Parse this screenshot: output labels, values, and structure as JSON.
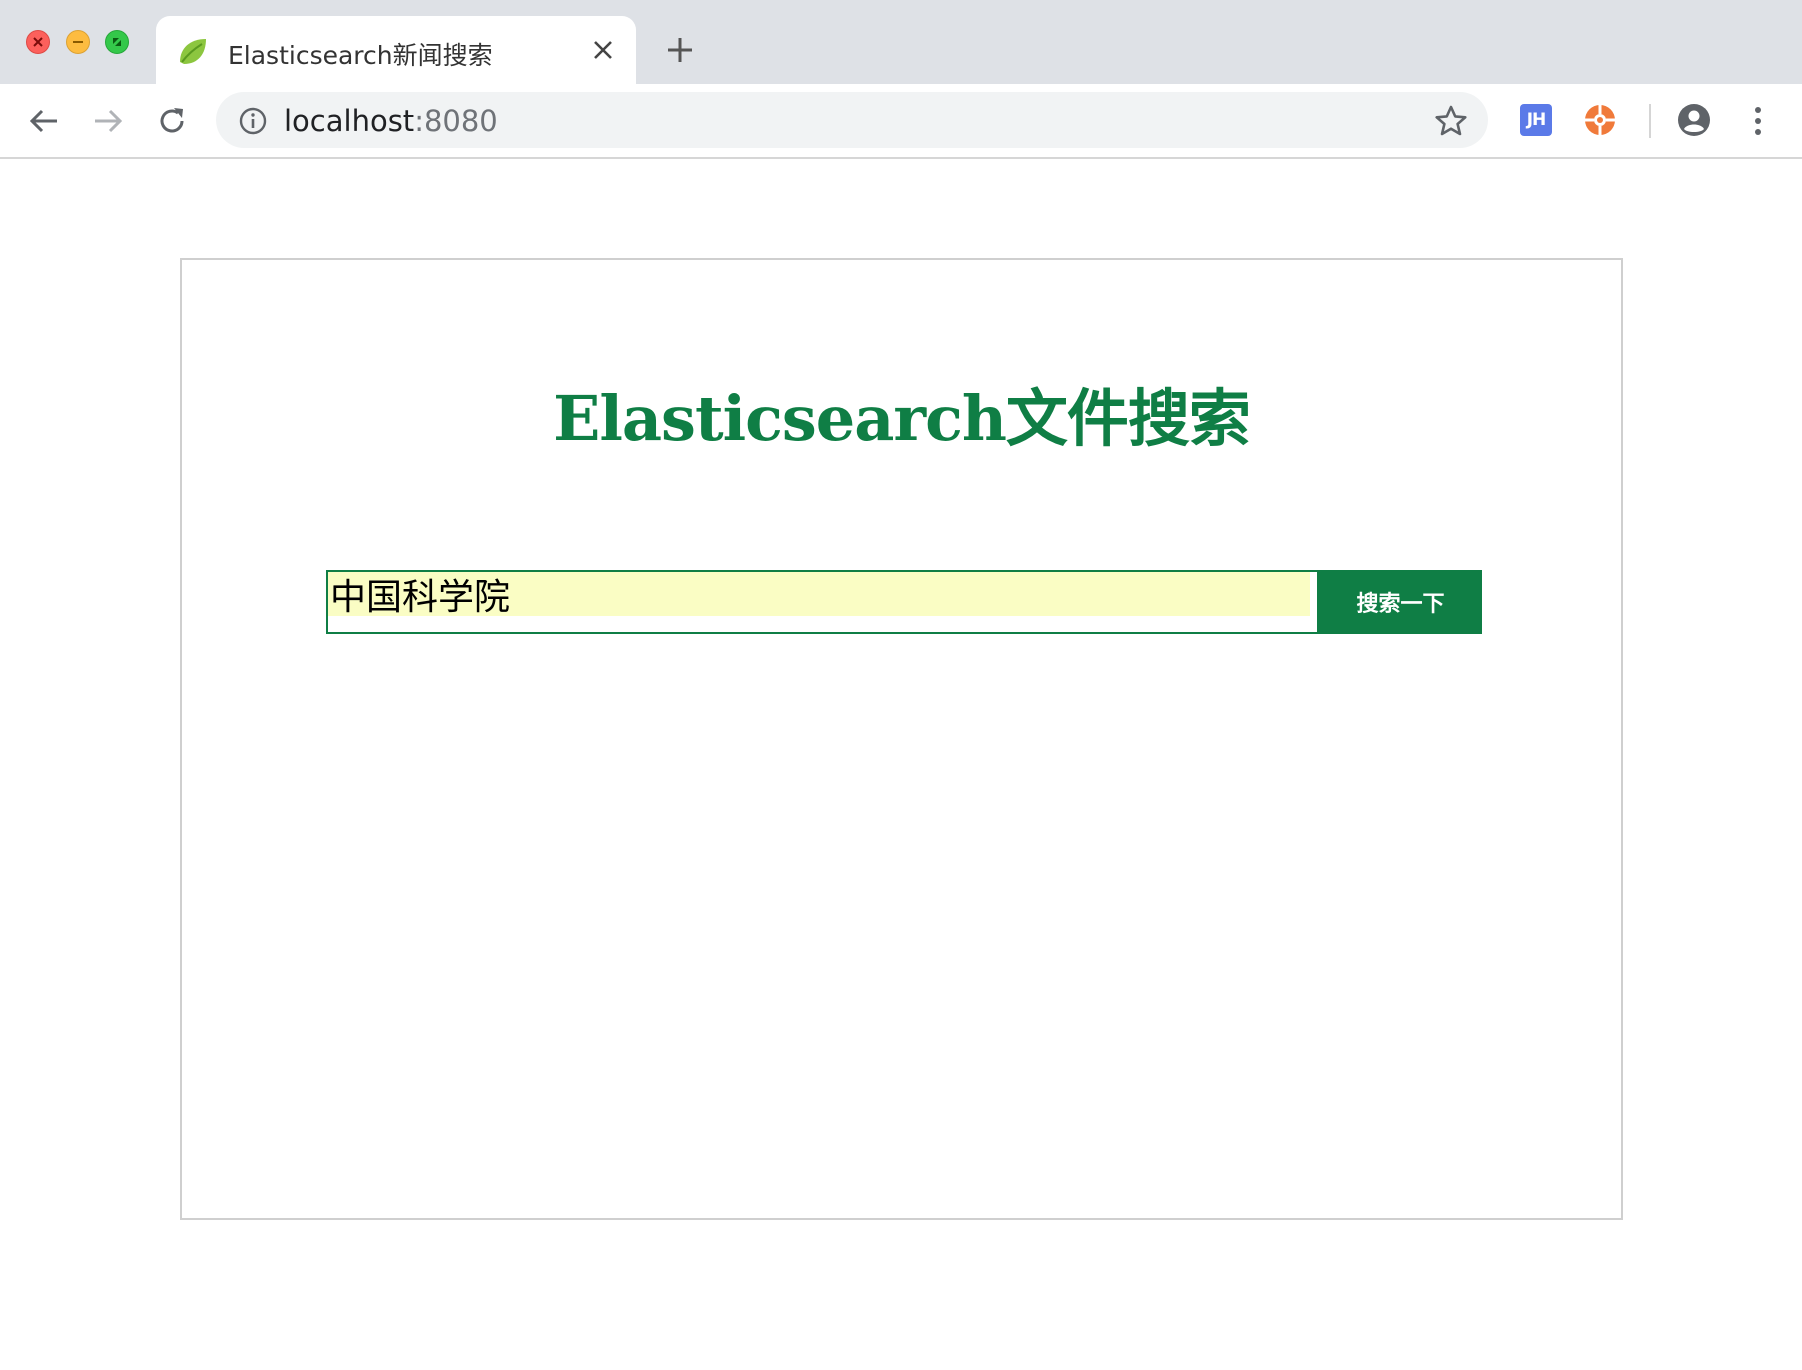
{
  "browser": {
    "tab": {
      "title": "Elasticsearch新闻搜索",
      "favicon": "spring-leaf-icon"
    },
    "address": {
      "host": "localhost",
      "port": ":8080"
    },
    "extensions": {
      "jh_label": "JH"
    }
  },
  "page": {
    "title": "Elasticsearch文件搜索",
    "search": {
      "value": "中国科学院",
      "button_label": "搜索一下"
    }
  },
  "colors": {
    "brand_green": "#0f7e45",
    "autofill_yellow": "#fafdc4",
    "tabbar": "#dee1e6"
  }
}
